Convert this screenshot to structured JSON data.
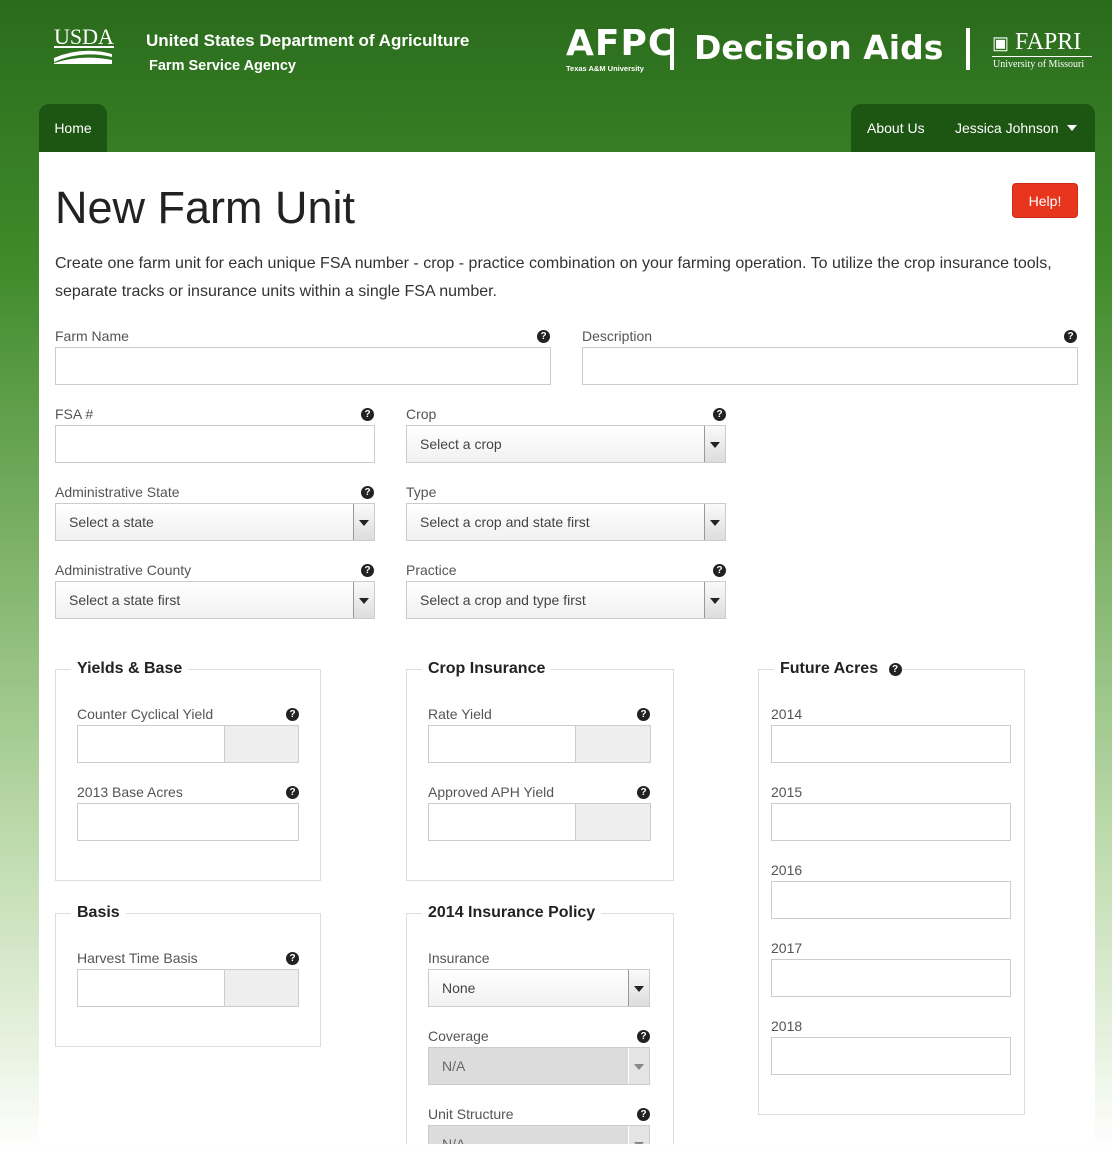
{
  "header": {
    "usda_logo": "USDA",
    "agency_name": "United States Department of Agriculture",
    "agency_sub": "Farm Service Agency",
    "afpc_logo": "AFPC",
    "afpc_sub": "Texas A&M University",
    "decision_aids": "Decision Aids",
    "fapri_logo": "FAPRI",
    "fapri_sub": "University of Missouri"
  },
  "nav": {
    "home": "Home",
    "about": "About Us",
    "user": "Jessica Johnson"
  },
  "page": {
    "title": "New Farm Unit",
    "help_button": "Help!",
    "intro": "Create one farm unit for each unique FSA number - crop - practice combination on your farming operation. To utilize the crop insurance tools, separate tracks or insurance units within a single FSA number."
  },
  "form": {
    "farm_name_label": "Farm Name",
    "description_label": "Description",
    "fsa_label": "FSA #",
    "crop_label": "Crop",
    "crop_value": "Select a crop",
    "admin_state_label": "Administrative State",
    "admin_state_value": "Select a state",
    "type_label": "Type",
    "type_value": "Select a crop and state first",
    "admin_county_label": "Administrative County",
    "admin_county_value": "Select a state first",
    "practice_label": "Practice",
    "practice_value": "Select a crop and type first"
  },
  "yields_base": {
    "legend": "Yields & Base",
    "counter_cyclical_label": "Counter Cyclical Yield",
    "base_acres_label": "2013 Base Acres"
  },
  "crop_insurance": {
    "legend": "Crop Insurance",
    "rate_yield_label": "Rate Yield",
    "aph_label": "Approved APH Yield"
  },
  "future_acres": {
    "legend": "Future Acres",
    "years": [
      "2014",
      "2015",
      "2016",
      "2017",
      "2018"
    ]
  },
  "basis": {
    "legend": "Basis",
    "harvest_label": "Harvest Time Basis"
  },
  "insurance_policy": {
    "legend": "2014 Insurance Policy",
    "insurance_label": "Insurance",
    "insurance_value": "None",
    "coverage_label": "Coverage",
    "coverage_value": "N/A",
    "unit_structure_label": "Unit Structure",
    "unit_structure_value": "N/A"
  },
  "help_icon": "question-circle-icon",
  "colors": {
    "header_green": "#2a6b1c",
    "nav_green": "#1d5512",
    "help_red": "#e7351e"
  }
}
